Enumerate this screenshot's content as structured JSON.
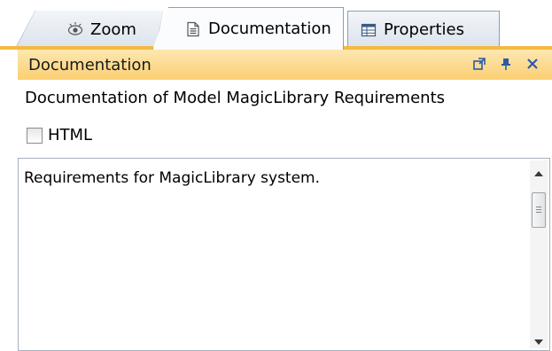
{
  "tabs": [
    {
      "label": "Zoom",
      "icon": "eye-icon"
    },
    {
      "label": "Documentation",
      "icon": "document-icon",
      "active": true
    },
    {
      "label": "Properties",
      "icon": "properties-table-icon"
    }
  ],
  "panel": {
    "title": "Documentation",
    "controls": [
      "popout-icon",
      "pin-icon",
      "close-icon"
    ],
    "subtitle": "Documentation of Model MagicLibrary Requirements",
    "html_checkbox": {
      "label": "HTML",
      "checked": false
    },
    "text_value": "Requirements for MagicLibrary system."
  },
  "colors": {
    "accent": "#f4ba3e",
    "header_light": "#fde7b0",
    "header_dark": "#fbcf73",
    "tab_border": "#8b9fb7"
  }
}
